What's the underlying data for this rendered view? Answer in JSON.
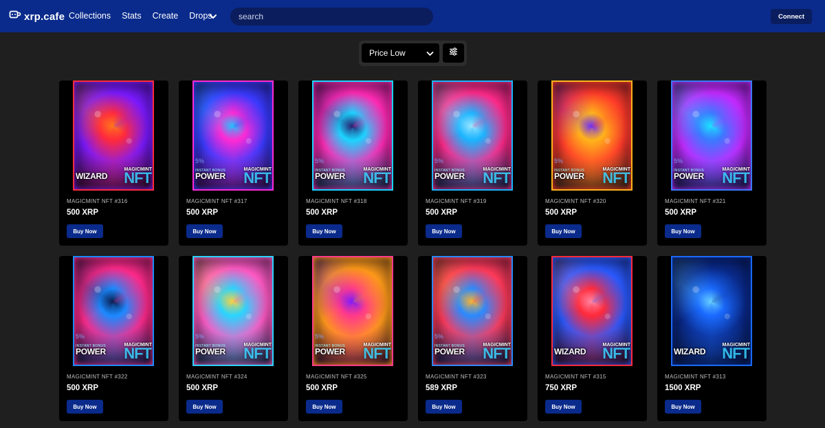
{
  "header": {
    "logo_text": "xrp.cafe",
    "nav": [
      "Collections",
      "Stats",
      "Create",
      "Drops"
    ],
    "search_placeholder": "search",
    "connect_label": "Connect"
  },
  "sort": {
    "selected": "Price Low"
  },
  "buy_label": "Buy Now",
  "cards": [
    {
      "name": "MAGICMINT NFT #316",
      "price": "500 XRP",
      "label": "WIZARD",
      "brand": "MAGICMINT",
      "nft": "NFT",
      "colors": [
        "#ff2a3c",
        "#7a1aff",
        "#ff7a1a"
      ]
    },
    {
      "name": "MAGICMINT NFT #317",
      "price": "500 XRP",
      "label": "POWER",
      "bonus": "INSTANT BONUS",
      "percent": "5%",
      "brand": "MAGICMINT",
      "nft": "NFT",
      "colors": [
        "#ff2ad4",
        "#3a3aff",
        "#1ac8ff"
      ]
    },
    {
      "name": "MAGICMINT NFT #318",
      "price": "500 XRP",
      "label": "POWER",
      "bonus": "INSTANT BONUS",
      "percent": "5%",
      "brand": "MAGICMINT",
      "nft": "NFT",
      "colors": [
        "#1ad4ff",
        "#ff2ab4",
        "#2a1a6a"
      ]
    },
    {
      "name": "MAGICMINT NFT #319",
      "price": "500 XRP",
      "label": "POWER",
      "bonus": "INSTANT BONUS",
      "percent": "5%",
      "brand": "MAGICMINT",
      "nft": "NFT",
      "colors": [
        "#1ab4ff",
        "#ff2a8a",
        "#a0e8ff"
      ]
    },
    {
      "name": "MAGICMINT NFT #320",
      "price": "500 XRP",
      "label": "POWER",
      "bonus": "INSTANT BONUS",
      "percent": "5%",
      "brand": "MAGICMINT",
      "nft": "NFT",
      "colors": [
        "#ffb41a",
        "#ff3a2a",
        "#6a2aff"
      ]
    },
    {
      "name": "MAGICMINT NFT #321",
      "price": "500 XRP",
      "label": "POWER",
      "bonus": "INSTANT BONUS",
      "percent": "5%",
      "brand": "MAGICMINT",
      "nft": "NFT",
      "colors": [
        "#3a7aff",
        "#c42aff",
        "#1ae8ff"
      ]
    },
    {
      "name": "MAGICMINT NFT #322",
      "price": "500 XRP",
      "label": "POWER",
      "bonus": "INSTANT BONUS",
      "percent": "5%",
      "brand": "MAGICMINT",
      "nft": "NFT",
      "colors": [
        "#1a8aff",
        "#ff2a8a",
        "#0a1a4a"
      ]
    },
    {
      "name": "MAGICMINT NFT #324",
      "price": "500 XRP",
      "label": "POWER",
      "bonus": "INSTANT BONUS",
      "percent": "5%",
      "brand": "MAGICMINT",
      "nft": "NFT",
      "colors": [
        "#2ad4ff",
        "#ff5ac4",
        "#ffd23a"
      ]
    },
    {
      "name": "MAGICMINT NFT #325",
      "price": "500 XRP",
      "label": "POWER",
      "bonus": "INSTANT BONUS",
      "percent": "5%",
      "brand": "MAGICMINT",
      "nft": "NFT",
      "colors": [
        "#ff3a8a",
        "#ff9a1a",
        "#7a1aff"
      ]
    },
    {
      "name": "MAGICMINT NFT #323",
      "price": "589 XRP",
      "label": "POWER",
      "bonus": "INSTANT BONUS",
      "percent": "5%",
      "brand": "MAGICMINT",
      "nft": "NFT",
      "colors": [
        "#2a8aff",
        "#ff3a5a",
        "#ffb42a"
      ]
    },
    {
      "name": "MAGICMINT NFT #315",
      "price": "750 XRP",
      "label": "WIZARD",
      "brand": "MAGICMINT",
      "nft": "NFT",
      "colors": [
        "#ff2a3a",
        "#2a5aff",
        "#ff8aa8"
      ]
    },
    {
      "name": "MAGICMINT NFT #313",
      "price": "1500 XRP",
      "label": "WIZARD",
      "brand": "MAGICMINT",
      "nft": "NFT",
      "colors": [
        "#1a6aff",
        "#0a2a8a",
        "#6ad4ff"
      ]
    }
  ]
}
